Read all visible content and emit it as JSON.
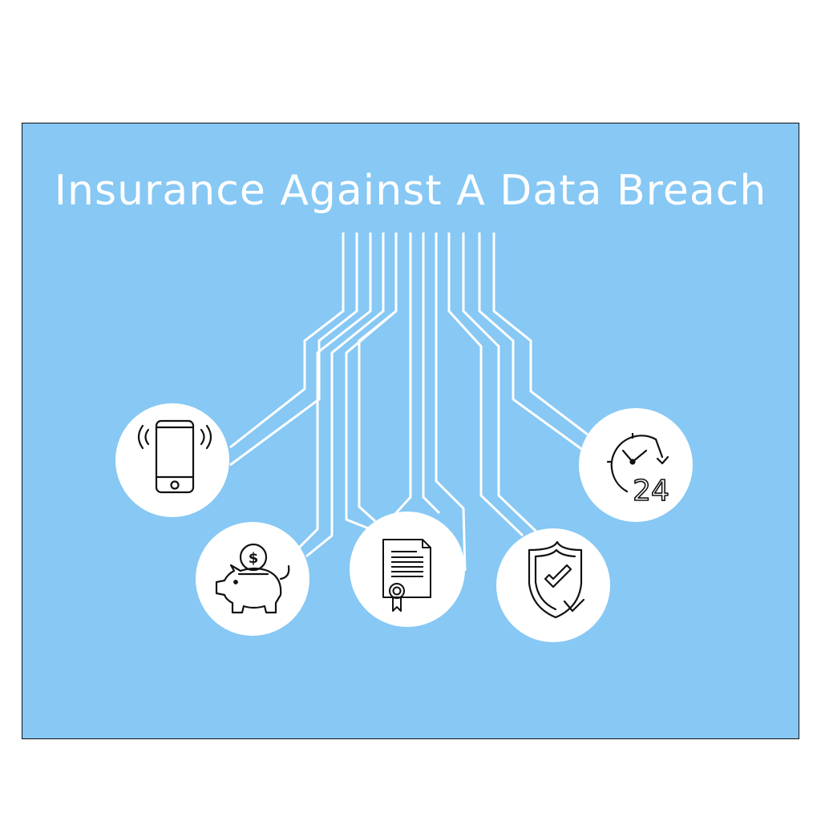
{
  "title": "Insurance Against A Data Breach",
  "colors": {
    "background": "#87c8f4",
    "lines": "#ffffff",
    "circle": "#ffffff",
    "icon": "#111111"
  },
  "icons": [
    {
      "name": "smartphone-icon"
    },
    {
      "name": "piggy-bank-icon"
    },
    {
      "name": "certificate-document-icon"
    },
    {
      "name": "shield-check-icon"
    },
    {
      "name": "clock-24-icon"
    }
  ]
}
